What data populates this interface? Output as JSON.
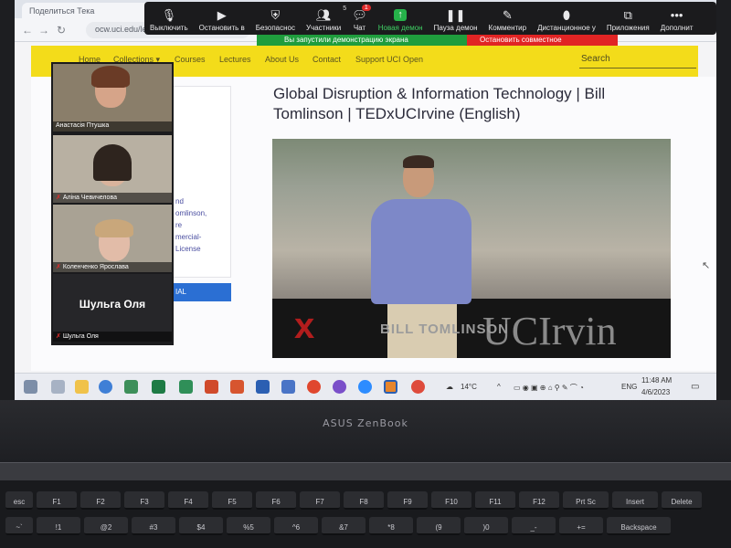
{
  "browser": {
    "tab_title": "Поделиться Тека",
    "url": "ocw.uci.edu/lectures/global_disruption_and_information_tec..."
  },
  "zoom_toolbar": {
    "items": [
      {
        "icon": "microphone-icon",
        "label": "Выключить"
      },
      {
        "icon": "video-camera-icon",
        "label": "Остановить в"
      },
      {
        "icon": "shield-icon",
        "label": "Безопаснос"
      },
      {
        "icon": "participants-icon",
        "label": "Участники",
        "count": "5"
      },
      {
        "icon": "chat-icon",
        "label": "Чат",
        "badge": "1"
      },
      {
        "icon": "share-screen-icon",
        "label": "Новая демон"
      },
      {
        "icon": "pause-icon",
        "label": "Пауза демон"
      },
      {
        "icon": "annotate-icon",
        "label": "Комментир"
      },
      {
        "icon": "remote-control-icon",
        "label": "Дистанционное у"
      },
      {
        "icon": "apps-icon",
        "label": "Приложения"
      },
      {
        "icon": "more-icon",
        "label": "Дополнит"
      }
    ],
    "share_status": "Вы запустили демонстрацию экрана",
    "stop_share": "Остановить совместное использование"
  },
  "site_nav": {
    "links": [
      "Home",
      "Collections ▾",
      "Courses",
      "Lectures",
      "About Us",
      "Contact",
      "Support UCI Open"
    ],
    "search_placeholder": "Search"
  },
  "page": {
    "title": "Global Disruption & Information Technology | Bill Tomlinson | TEDxUCIrvine (English)",
    "side_text": "nd\nomlinson,\nre\nmercial-\nLicense",
    "side_button": "IAL"
  },
  "video": {
    "stage_text": "BILL TOMLINSON",
    "stage_big": "UCIrvin",
    "logo_text": "x"
  },
  "participants": [
    {
      "name": "Анастасія Птушка",
      "muted": false
    },
    {
      "name": "Аліна Чевичелова",
      "muted": true
    },
    {
      "name": "Коленченко Ярослава",
      "muted": true
    },
    {
      "name": "Шульга Оля",
      "muted": true,
      "display_name": "Шульга Оля"
    }
  ],
  "taskbar": {
    "weather": "14°C",
    "language": "ENG",
    "time": "11:48 AM",
    "date": "4/6/2023"
  },
  "laptop": {
    "brand": "ASUS ZenBook"
  },
  "keyboard": {
    "row1": [
      "esc",
      "F1",
      "F2",
      "F3",
      "F4",
      "F5",
      "F6",
      "F7",
      "F8",
      "F9",
      "F10",
      "F11",
      "F12",
      "Prt Sc",
      "Insert",
      "Delete"
    ],
    "row2": [
      "~`",
      "!1",
      "@2",
      "#3",
      "$4",
      "%5",
      "^6",
      "&7",
      "*8",
      "(9",
      ")0",
      "_-",
      "+=",
      "Backspace"
    ]
  }
}
